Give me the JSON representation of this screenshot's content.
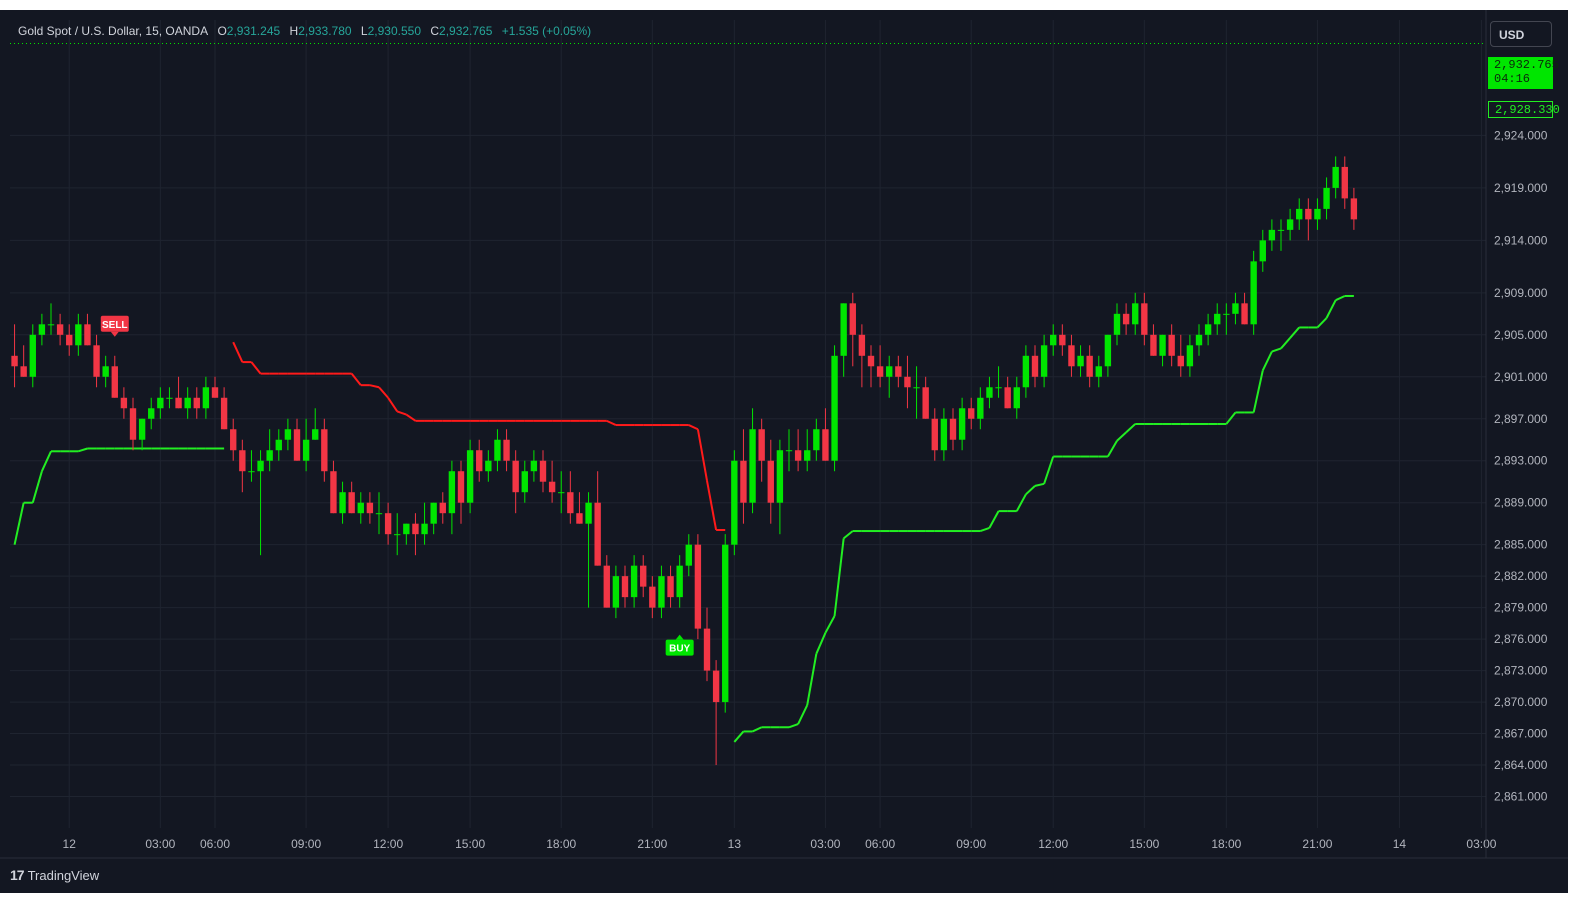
{
  "legend": {
    "symbol": "Gold Spot / U.S. Dollar, 15, OANDA",
    "o_label": "O",
    "o_value": "2,931.245",
    "h_label": "H",
    "h_value": "2,933.780",
    "l_label": "L",
    "l_value": "2,930.550",
    "c_label": "C",
    "c_value": "2,932.765",
    "change": "+1.535 (+0.05%)"
  },
  "currency": "USD",
  "footer": {
    "brand": "TradingView",
    "logo_glyph": "17"
  },
  "price_tags": {
    "last_price": "2,932.765",
    "countdown": "04:16",
    "indicator_price": "2,928.330"
  },
  "signals": {
    "sell": "SELL",
    "buy": "BUY"
  },
  "colors": {
    "background": "#131722",
    "up": "#00e600",
    "down": "#f23645",
    "indicator_up": "#22ee22",
    "indicator_down": "#ff1a1a",
    "grid": "#1f2430",
    "text": "#b2b5be"
  },
  "chart_data": {
    "type": "candlestick",
    "y_ticks": [
      "2,924.000",
      "2,919.000",
      "2,914.000",
      "2,909.000",
      "2,905.000",
      "2,901.000",
      "2,897.000",
      "2,893.000",
      "2,889.000",
      "2,885.000",
      "2,882.000",
      "2,879.000",
      "2,876.000",
      "2,873.000",
      "2,870.000",
      "2,867.000",
      "2,864.000",
      "2,861.000"
    ],
    "y_tick_values": [
      2924,
      2919,
      2914,
      2909,
      2905,
      2901,
      2897,
      2893,
      2889,
      2885,
      2882,
      2879,
      2876,
      2873,
      2870,
      2867,
      2864,
      2861
    ],
    "x_ticks": [
      {
        "label": "12",
        "bar": 6
      },
      {
        "label": "03:00",
        "bar": 16
      },
      {
        "label": "06:00",
        "bar": 22
      },
      {
        "label": "09:00",
        "bar": 32
      },
      {
        "label": "12:00",
        "bar": 41
      },
      {
        "label": "15:00",
        "bar": 50
      },
      {
        "label": "18:00",
        "bar": 60
      },
      {
        "label": "21:00",
        "bar": 70
      },
      {
        "label": "13",
        "bar": 79
      },
      {
        "label": "03:00",
        "bar": 89
      },
      {
        "label": "06:00",
        "bar": 95
      },
      {
        "label": "09:00",
        "bar": 105
      },
      {
        "label": "12:00",
        "bar": 114
      },
      {
        "label": "15:00",
        "bar": 124
      },
      {
        "label": "18:00",
        "bar": 133
      },
      {
        "label": "21:00",
        "bar": 143
      },
      {
        "label": "14",
        "bar": 152
      },
      {
        "label": "03:00",
        "bar": 161
      }
    ],
    "y_range": [
      2858,
      2935
    ],
    "bar_count": 162,
    "candles": [
      [
        2903,
        2906,
        2900,
        2902
      ],
      [
        2902,
        2904,
        2901,
        2901
      ],
      [
        2901,
        2906,
        2900,
        2905
      ],
      [
        2905,
        2907,
        2904,
        2906
      ],
      [
        2906,
        2908,
        2905,
        2906
      ],
      [
        2906,
        2907,
        2904,
        2905
      ],
      [
        2905,
        2906,
        2903,
        2904
      ],
      [
        2904,
        2907,
        2903,
        2906
      ],
      [
        2906,
        2907,
        2904,
        2904
      ],
      [
        2904,
        2905,
        2900,
        2901
      ],
      [
        2901,
        2903,
        2900,
        2902
      ],
      [
        2902,
        2903,
        2899,
        2899
      ],
      [
        2899,
        2900,
        2897,
        2898
      ],
      [
        2898,
        2899,
        2894,
        2895
      ],
      [
        2895,
        2897,
        2894,
        2897
      ],
      [
        2897,
        2899,
        2896,
        2898
      ],
      [
        2898,
        2900,
        2897,
        2899
      ],
      [
        2899,
        2900,
        2898,
        2899
      ],
      [
        2899,
        2901,
        2898,
        2898
      ],
      [
        2898,
        2900,
        2897,
        2899
      ],
      [
        2899,
        2900,
        2897,
        2898
      ],
      [
        2898,
        2901,
        2897,
        2900
      ],
      [
        2900,
        2901,
        2899,
        2899
      ],
      [
        2899,
        2900,
        2896,
        2896
      ],
      [
        2896,
        2897,
        2893,
        2894
      ],
      [
        2894,
        2895,
        2890,
        2892
      ],
      [
        2892,
        2894,
        2891,
        2892
      ],
      [
        2892,
        2894,
        2884,
        2893
      ],
      [
        2893,
        2896,
        2892,
        2894
      ],
      [
        2894,
        2896,
        2893,
        2895
      ],
      [
        2895,
        2897,
        2894,
        2896
      ],
      [
        2896,
        2897,
        2893,
        2893
      ],
      [
        2893,
        2897,
        2892,
        2895
      ],
      [
        2895,
        2898,
        2895,
        2896
      ],
      [
        2896,
        2897,
        2891,
        2892
      ],
      [
        2892,
        2893,
        2888,
        2888
      ],
      [
        2888,
        2891,
        2887,
        2890
      ],
      [
        2890,
        2891,
        2888,
        2888
      ],
      [
        2888,
        2890,
        2887,
        2889
      ],
      [
        2889,
        2890,
        2887,
        2888
      ],
      [
        2888,
        2890,
        2886,
        2888
      ],
      [
        2888,
        2889,
        2885,
        2886
      ],
      [
        2886,
        2888,
        2884,
        2886
      ],
      [
        2886,
        2887,
        2885,
        2887
      ],
      [
        2887,
        2888,
        2884,
        2886
      ],
      [
        2886,
        2889,
        2885,
        2887
      ],
      [
        2887,
        2889,
        2886,
        2889
      ],
      [
        2889,
        2890,
        2887,
        2888
      ],
      [
        2888,
        2893,
        2886,
        2892
      ],
      [
        2892,
        2893,
        2887,
        2889
      ],
      [
        2889,
        2895,
        2888,
        2894
      ],
      [
        2894,
        2895,
        2891,
        2892
      ],
      [
        2892,
        2894,
        2891,
        2893
      ],
      [
        2893,
        2896,
        2892,
        2895
      ],
      [
        2895,
        2896,
        2892,
        2893
      ],
      [
        2893,
        2894,
        2888,
        2890
      ],
      [
        2890,
        2893,
        2889,
        2892
      ],
      [
        2892,
        2894,
        2891,
        2893
      ],
      [
        2893,
        2894,
        2890,
        2891
      ],
      [
        2891,
        2893,
        2889,
        2890
      ],
      [
        2890,
        2892,
        2888,
        2890
      ],
      [
        2890,
        2892,
        2887,
        2888
      ],
      [
        2888,
        2890,
        2887,
        2887
      ],
      [
        2887,
        2890,
        2879,
        2889
      ],
      [
        2889,
        2892,
        2883,
        2883
      ],
      [
        2883,
        2884,
        2879,
        2879
      ],
      [
        2879,
        2883,
        2878,
        2882
      ],
      [
        2882,
        2883,
        2879,
        2880
      ],
      [
        2880,
        2884,
        2879,
        2883
      ],
      [
        2883,
        2884,
        2880,
        2881
      ],
      [
        2881,
        2882,
        2878,
        2879
      ],
      [
        2879,
        2883,
        2878,
        2882
      ],
      [
        2882,
        2883,
        2879,
        2880
      ],
      [
        2880,
        2884,
        2879,
        2883
      ],
      [
        2883,
        2886,
        2882,
        2885
      ],
      [
        2885,
        2886,
        2876,
        2877
      ],
      [
        2877,
        2879,
        2872,
        2873
      ],
      [
        2873,
        2874,
        2864,
        2870
      ],
      [
        2870,
        2886,
        2869,
        2885
      ],
      [
        2885,
        2894,
        2884,
        2893
      ],
      [
        2893,
        2896,
        2887,
        2889
      ],
      [
        2889,
        2898,
        2888,
        2896
      ],
      [
        2896,
        2897,
        2891,
        2893
      ],
      [
        2893,
        2895,
        2887,
        2889
      ],
      [
        2889,
        2895,
        2886,
        2894
      ],
      [
        2894,
        2896,
        2892,
        2894
      ],
      [
        2894,
        2896,
        2892,
        2893
      ],
      [
        2893,
        2896,
        2892,
        2894
      ],
      [
        2894,
        2897,
        2893,
        2896
      ],
      [
        2896,
        2898,
        2893,
        2893
      ],
      [
        2893,
        2904,
        2892,
        2903
      ],
      [
        2903,
        2908,
        2901,
        2908
      ],
      [
        2908,
        2909,
        2902,
        2905
      ],
      [
        2905,
        2906,
        2900,
        2903
      ],
      [
        2903,
        2904,
        2900,
        2902
      ],
      [
        2902,
        2904,
        2900,
        2901
      ],
      [
        2901,
        2903,
        2899,
        2902
      ],
      [
        2902,
        2903,
        2900,
        2901
      ],
      [
        2901,
        2903,
        2898,
        2900
      ],
      [
        2900,
        2902,
        2897,
        2900
      ],
      [
        2900,
        2901,
        2897,
        2897
      ],
      [
        2897,
        2898,
        2893,
        2894
      ],
      [
        2894,
        2898,
        2893,
        2897
      ],
      [
        2897,
        2898,
        2894,
        2895
      ],
      [
        2895,
        2899,
        2894,
        2898
      ],
      [
        2898,
        2899,
        2896,
        2897
      ],
      [
        2897,
        2900,
        2896,
        2899
      ],
      [
        2899,
        2901,
        2898,
        2900
      ],
      [
        2900,
        2902,
        2899,
        2900
      ],
      [
        2900,
        2901,
        2898,
        2898
      ],
      [
        2898,
        2901,
        2897,
        2900
      ],
      [
        2900,
        2904,
        2899,
        2903
      ],
      [
        2903,
        2904,
        2900,
        2901
      ],
      [
        2901,
        2905,
        2900,
        2904
      ],
      [
        2904,
        2906,
        2903,
        2905
      ],
      [
        2905,
        2906,
        2903,
        2904
      ],
      [
        2904,
        2905,
        2901,
        2902
      ],
      [
        2902,
        2904,
        2901,
        2903
      ],
      [
        2903,
        2904,
        2900,
        2901
      ],
      [
        2901,
        2903,
        2900,
        2902
      ],
      [
        2902,
        2905,
        2901,
        2905
      ],
      [
        2905,
        2908,
        2904,
        2907
      ],
      [
        2907,
        2908,
        2905,
        2906
      ],
      [
        2906,
        2909,
        2905,
        2908
      ],
      [
        2908,
        2909,
        2904,
        2905
      ],
      [
        2905,
        2906,
        2903,
        2903
      ],
      [
        2903,
        2905,
        2902,
        2905
      ],
      [
        2905,
        2906,
        2902,
        2903
      ],
      [
        2903,
        2905,
        2901,
        2902
      ],
      [
        2902,
        2905,
        2901,
        2904
      ],
      [
        2904,
        2906,
        2903,
        2905
      ],
      [
        2905,
        2907,
        2904,
        2906
      ],
      [
        2906,
        2908,
        2905,
        2907
      ],
      [
        2907,
        2908,
        2905,
        2907
      ],
      [
        2907,
        2909,
        2906,
        2908
      ],
      [
        2908,
        2909,
        2906,
        2906
      ],
      [
        2906,
        2913,
        2905,
        2912
      ],
      [
        2912,
        2915,
        2911,
        2914
      ],
      [
        2914,
        2916,
        2913,
        2915
      ],
      [
        2915,
        2916,
        2913,
        2915
      ],
      [
        2915,
        2917,
        2914,
        2916
      ],
      [
        2916,
        2918,
        2915,
        2917
      ],
      [
        2917,
        2918,
        2914,
        2916
      ],
      [
        2916,
        2918,
        2915,
        2917
      ],
      [
        2917,
        2920,
        2916,
        2919
      ],
      [
        2919,
        2922,
        2918,
        2921
      ],
      [
        2921,
        2922,
        2917,
        2918
      ],
      [
        2918,
        2919,
        2915,
        2916
      ]
    ],
    "indicator": "supertrend",
    "signals": [
      {
        "type": "sell",
        "bar": 11
      },
      {
        "type": "buy",
        "bar": 73
      }
    ]
  }
}
